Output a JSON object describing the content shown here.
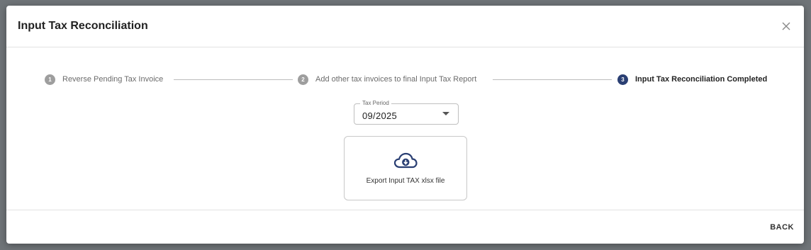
{
  "dialog": {
    "title": "Input Tax Reconciliation",
    "close_icon": "close-icon"
  },
  "stepper": {
    "steps": [
      {
        "number": "1",
        "label": "Reverse Pending Tax Invoice",
        "state": "completed"
      },
      {
        "number": "2",
        "label": "Add other tax invoices to final Input Tax Report",
        "state": "completed"
      },
      {
        "number": "3",
        "label": "Input Tax Reconciliation Completed",
        "state": "active"
      }
    ]
  },
  "tax_period": {
    "label": "Tax Period",
    "value": "09/2025",
    "dropdown_icon": "caret-down-icon"
  },
  "export": {
    "label": "Export Input TAX xlsx file",
    "icon": "cloud-download-icon"
  },
  "footer": {
    "back_label": "BACK"
  },
  "colors": {
    "accent": "#2a3f73",
    "inactive_step": "#9e9e9e"
  }
}
